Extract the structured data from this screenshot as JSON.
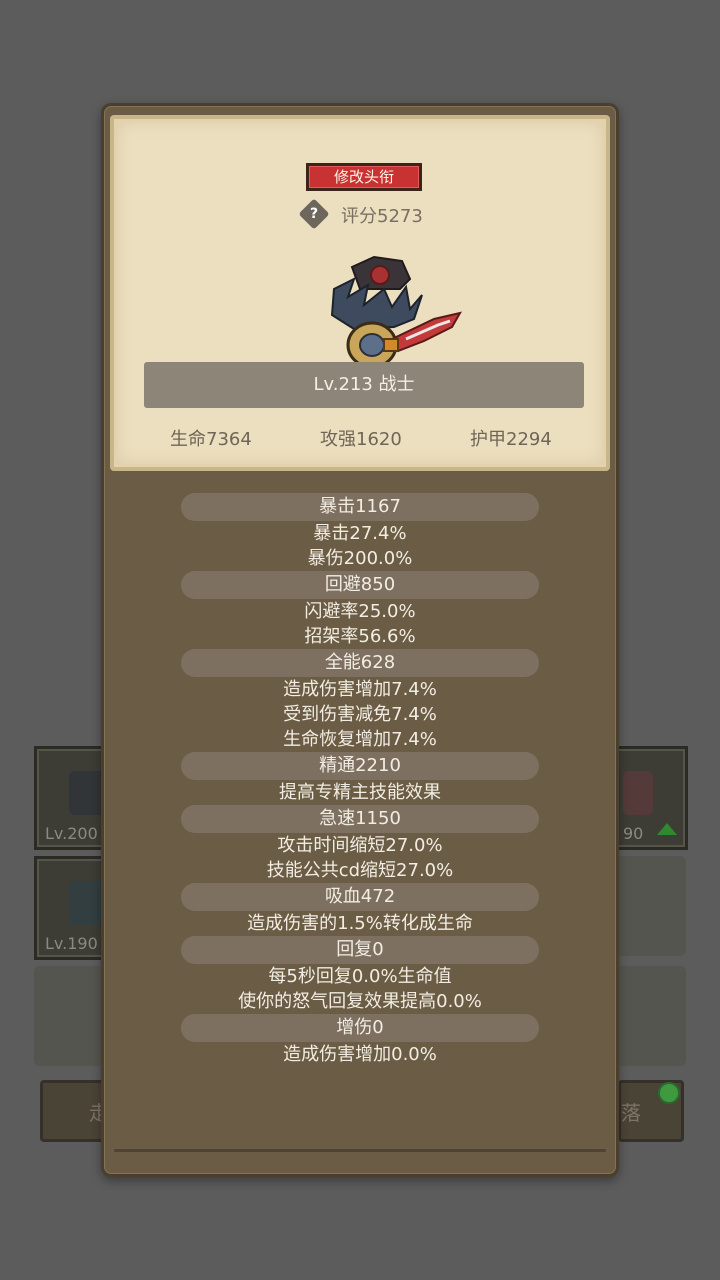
{
  "background": {
    "slots": [
      {
        "level": "Lv.200"
      },
      {
        "level": "Lv.190"
      },
      {
        "level": "90"
      }
    ],
    "buttons": [
      "走",
      "落"
    ]
  },
  "profile": {
    "change_title_label": "修改头衔",
    "score": "评分5273",
    "level_class": "Lv.213 战士",
    "hp": "生命7364",
    "attack": "攻强1620",
    "armor": "护甲2294"
  },
  "stats": [
    {
      "header": "暴击1167",
      "lines": [
        "暴击27.4%",
        "暴伤200.0%"
      ]
    },
    {
      "header": "回避850",
      "lines": [
        "闪避率25.0%",
        "招架率56.6%"
      ]
    },
    {
      "header": "全能628",
      "lines": [
        "造成伤害增加7.4%",
        "受到伤害减免7.4%",
        "生命恢复增加7.4%"
      ]
    },
    {
      "header": "精通2210",
      "lines": [
        "提高专精主技能效果"
      ]
    },
    {
      "header": "急速1150",
      "lines": [
        "攻击时间缩短27.0%",
        "技能公共cd缩短27.0%"
      ]
    },
    {
      "header": "吸血472",
      "lines": [
        "造成伤害的1.5%转化成生命"
      ]
    },
    {
      "header": "回复0",
      "lines": [
        "每5秒回复0.0%生命值",
        "使你的怒气回复效果提高0.0%"
      ]
    },
    {
      "header": "增伤0",
      "lines": [
        "造成伤害增加0.0%"
      ]
    }
  ],
  "colors": {
    "accent_red": "#c83232",
    "panel": "#6b5d45",
    "parchment": "#ecdfbf"
  }
}
